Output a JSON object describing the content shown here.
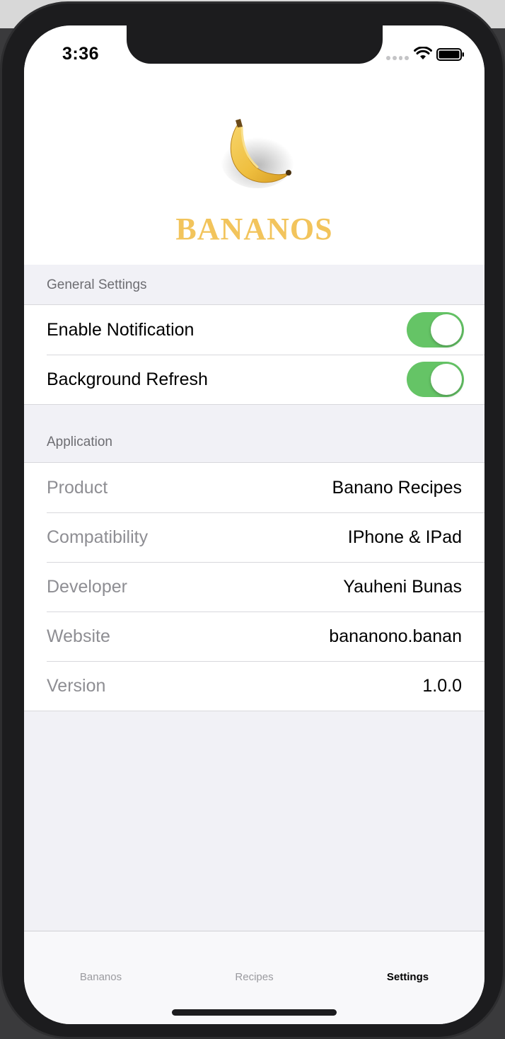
{
  "status_bar": {
    "time": "3:36",
    "icons": [
      "cellular-signal-icon",
      "wifi-icon",
      "battery-icon"
    ]
  },
  "header": {
    "logo_icon": "banana-icon",
    "brand": "BANANOS",
    "brand_color": "#f2c45c"
  },
  "general_settings": {
    "title": "General Settings",
    "rows": [
      {
        "label": "Enable Notification",
        "enabled": true
      },
      {
        "label": "Background Refresh",
        "enabled": true
      }
    ]
  },
  "application": {
    "title": "Application",
    "rows": [
      {
        "key": "Product",
        "value": "Banano Recipes"
      },
      {
        "key": "Compatibility",
        "value": "IPhone & IPad"
      },
      {
        "key": "Developer",
        "value": "Yauheni Bunas"
      },
      {
        "key": "Website",
        "value": "bananono.banan"
      },
      {
        "key": "Version",
        "value": "1.0.0"
      }
    ]
  },
  "tab_bar": {
    "tabs": [
      {
        "label": "Bananos",
        "active": false
      },
      {
        "label": "Recipes",
        "active": false
      },
      {
        "label": "Settings",
        "active": true
      }
    ]
  },
  "colors": {
    "toggle_on": "#65c466",
    "grouped_background": "#f1f1f6",
    "secondary_text": "#8e8e93"
  }
}
